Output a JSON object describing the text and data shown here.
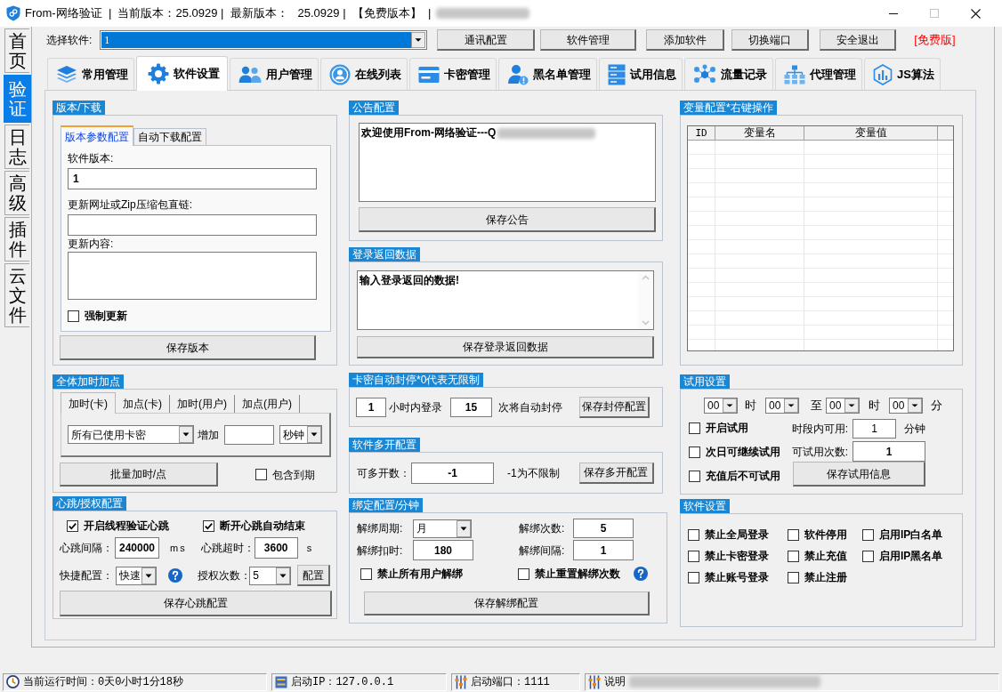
{
  "window": {
    "title": "From-网络验证  |  当前版本：25.0929 |  最新版本：   25.0929 |  【免费版本】  |",
    "redacted": true,
    "controls": [
      {
        "kind": "minimize",
        "disabled": false
      },
      {
        "kind": "maximize",
        "disabled": true
      },
      {
        "kind": "close",
        "disabled": false
      }
    ]
  },
  "side_tabs": [
    {
      "label": "首页",
      "selected": false
    },
    {
      "label": "验证",
      "selected": true
    },
    {
      "label": "日志",
      "selected": false
    },
    {
      "label": "高级",
      "selected": false
    },
    {
      "label": "插件",
      "selected": false
    },
    {
      "label": "云文件",
      "selected": false
    }
  ],
  "toolbar": {
    "software_label": "选择软件:",
    "software_value": "1",
    "buttons": [
      "通讯配置",
      "软件管理",
      "添加软件",
      "切换端口",
      "安全退出"
    ],
    "edition": "[免费版]"
  },
  "tabs": [
    {
      "label": "常用管理",
      "selected": false
    },
    {
      "label": "软件设置",
      "selected": true
    },
    {
      "label": "用户管理",
      "selected": false
    },
    {
      "label": "在线列表",
      "selected": false
    },
    {
      "label": "卡密管理",
      "selected": false
    },
    {
      "label": "黑名单管理",
      "selected": false
    },
    {
      "label": "试用信息",
      "selected": false
    },
    {
      "label": "流量记录",
      "selected": false
    },
    {
      "label": "代理管理",
      "selected": false
    },
    {
      "label": "JS算法",
      "selected": false
    }
  ],
  "version_download": {
    "title": "版本/下载",
    "tabs": [
      {
        "label": "版本参数配置",
        "selected": true
      },
      {
        "label": "自动下载配置",
        "selected": false
      }
    ],
    "fields": [
      {
        "label": "软件版本:",
        "kind": "line",
        "value": "1"
      },
      {
        "label": "更新网址或Zip压缩包直链:",
        "kind": "line"
      },
      {
        "label": "更新内容:",
        "kind": "multiline"
      }
    ],
    "force_update": {
      "label": "强制更新",
      "checked": false
    },
    "save_button": "保存版本"
  },
  "add_time_points": {
    "title": "全体加时加点",
    "tabs": [
      {
        "label": "加时(卡)",
        "selected": true
      },
      {
        "label": "加点(卡)",
        "selected": false
      },
      {
        "label": "加时(用户)",
        "selected": false
      },
      {
        "label": "加点(用户)",
        "selected": false
      }
    ],
    "target": "所有已使用卡密",
    "add_label": "增加",
    "unit": "秒钟",
    "batch_button": "批量加时/点",
    "include_expired": {
      "label": "包含到期",
      "checked": false
    }
  },
  "heartbeat": {
    "title": "心跳/授权配置",
    "options": [
      {
        "label": "开启线程验证心跳",
        "checked": true
      },
      {
        "label": "断开心跳自动结束",
        "checked": true
      }
    ],
    "interval": {
      "label": "心跳间隔：",
      "value": "240000",
      "unit": "ms"
    },
    "timeout": {
      "label": "心跳超时：",
      "value": "3600",
      "unit": "s"
    },
    "preset": {
      "label": "快捷配置：",
      "value": "快速"
    },
    "auth_count": {
      "label": "授权次数：",
      "value": "5"
    },
    "config_button": "配置",
    "save_button": "保存心跳配置"
  },
  "announcement": {
    "title": "公告配置",
    "text": "欢迎使用From-网络验证---Q",
    "redacted": true,
    "save_button": "保存公告"
  },
  "login_return": {
    "title": "登录返回数据",
    "text": "输入登录返回的数据!",
    "save_button": "保存登录返回数据"
  },
  "card_autoban": {
    "title": "卡密自动封停*0代表无限制",
    "hours": "1",
    "hours_label": "小时内登录",
    "count": "15",
    "count_label": "次将自动封停",
    "save_button": "保存封停配置"
  },
  "multi_open": {
    "title": "软件多开配置",
    "label": "可多开数：",
    "value": "-1",
    "hint": "-1为不限制",
    "save_button": "保存多开配置"
  },
  "binding": {
    "title": "绑定配置/分钟",
    "period": {
      "label": "解绑周期:",
      "value": "月"
    },
    "count": {
      "label": "解绑次数:",
      "value": "5"
    },
    "deduct": {
      "label": "解绑扣时:",
      "value": "180"
    },
    "interval": {
      "label": "解绑间隔:",
      "value": "1"
    },
    "options": [
      {
        "label": "禁止所有用户解绑",
        "checked": false
      },
      {
        "label": "禁止重置解绑次数",
        "checked": false
      }
    ],
    "save_button": "保存解绑配置"
  },
  "variables": {
    "title": "变量配置*右键操作",
    "columns": [
      "ID",
      "变量名",
      "变量值"
    ]
  },
  "trial": {
    "title": "试用设置",
    "time_selects": [
      {
        "value": "00",
        "suffix": "时"
      },
      {
        "value": "00",
        "suffix": "至"
      },
      {
        "value": "00",
        "suffix": "时"
      },
      {
        "value": "00",
        "suffix": "分"
      }
    ],
    "options": [
      {
        "label": "开启试用",
        "checked": false
      },
      {
        "label": "次日可继续试用",
        "checked": false
      },
      {
        "label": "充值后不可试用",
        "checked": false
      }
    ],
    "period_minutes": {
      "label": "时段内可用:",
      "value": "1",
      "unit": "分钟"
    },
    "trial_count": {
      "label": "可试用次数:",
      "value": "1"
    },
    "save_button": "保存试用信息"
  },
  "software_settings": {
    "title": "软件设置",
    "options": [
      {
        "label": "禁止全局登录",
        "checked": false
      },
      {
        "label": "软件停用",
        "checked": false
      },
      {
        "label": "启用IP白名单",
        "checked": false
      },
      {
        "label": "禁止卡密登录",
        "checked": false
      },
      {
        "label": "禁止充值",
        "checked": false
      },
      {
        "label": "启用IP黑名单",
        "checked": false
      },
      {
        "label": "禁止账号登录",
        "checked": false
      },
      {
        "label": "禁止注册",
        "checked": false
      }
    ]
  },
  "status_bar": [
    {
      "text": "当前运行时间：0天0小时1分18秒"
    },
    {
      "text": "启动IP：127.0.0.1"
    },
    {
      "text": "启动端口：1111"
    },
    {
      "text": "说明",
      "redacted": true
    }
  ]
}
